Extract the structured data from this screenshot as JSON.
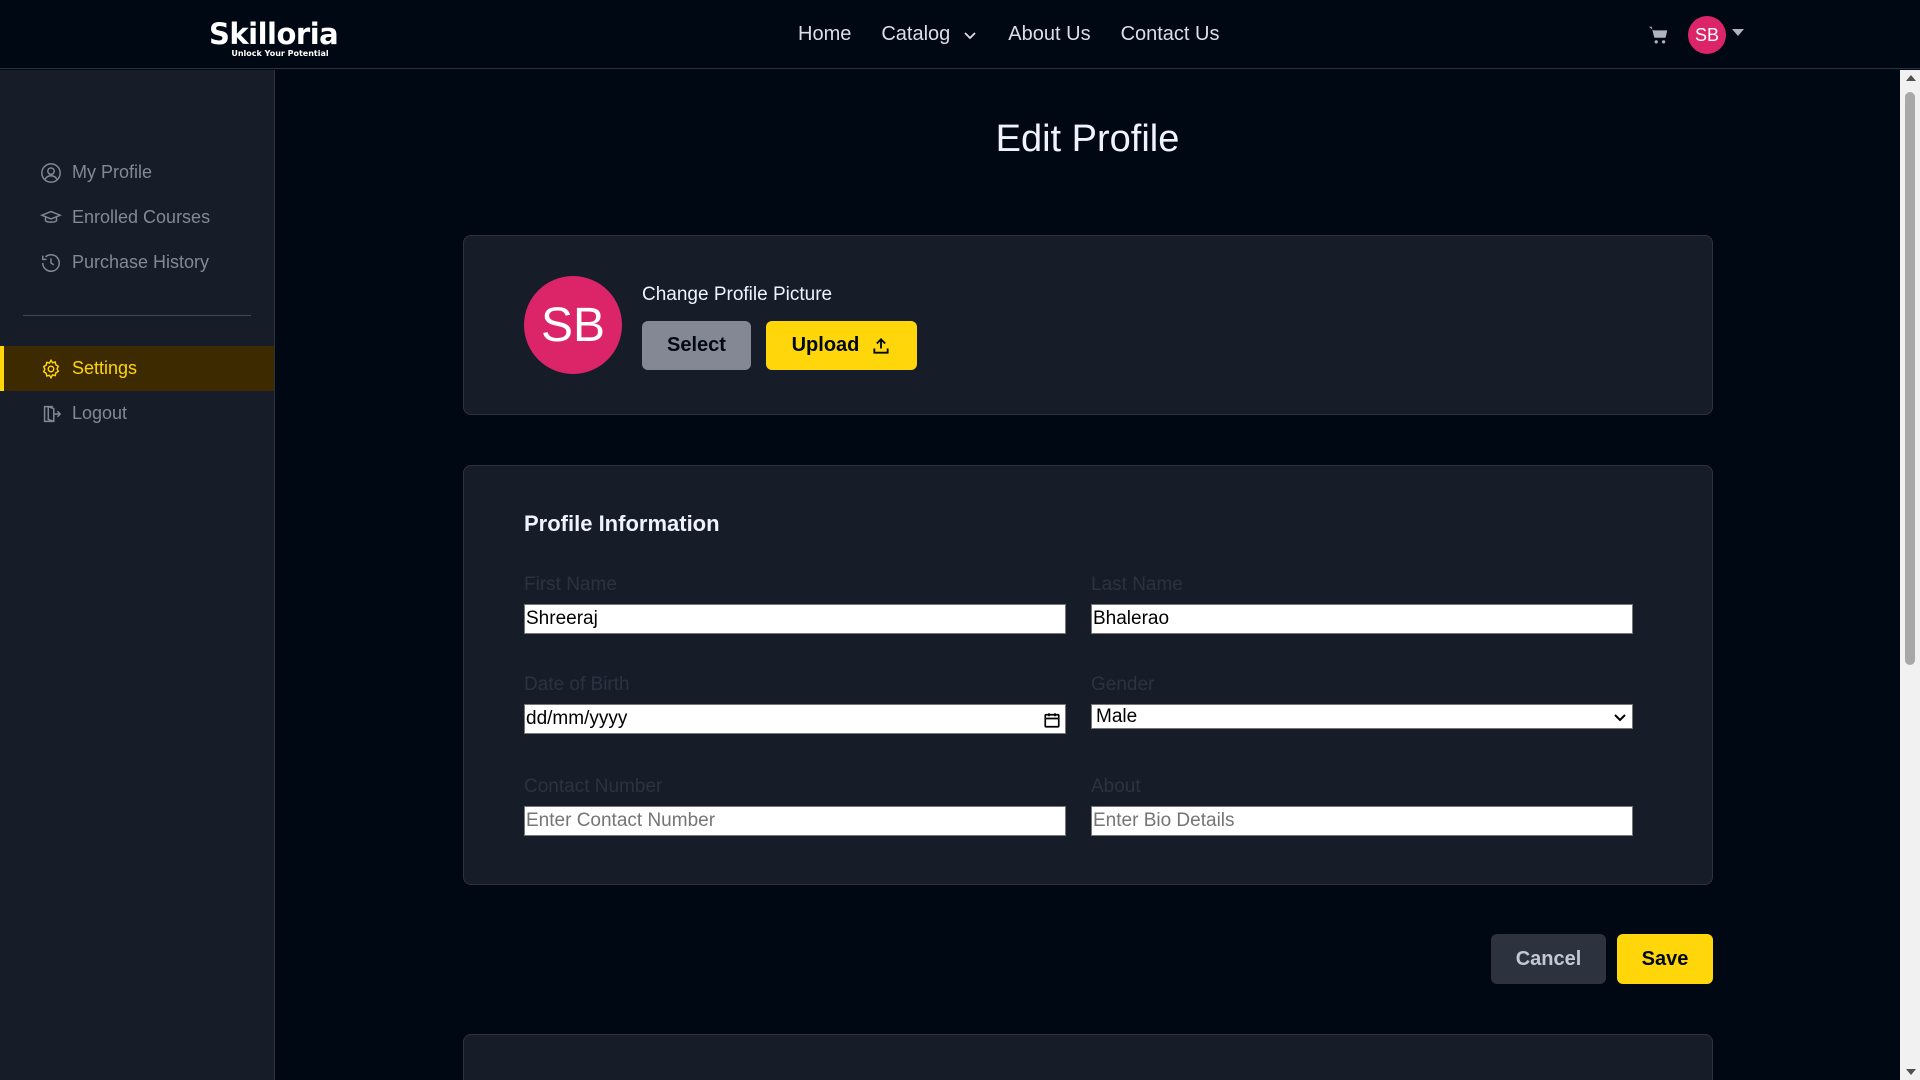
{
  "brand": {
    "name": "Skilloria",
    "tagline": "Unlock Your Potential"
  },
  "nav": {
    "links": [
      "Home",
      "Catalog",
      "About Us",
      "Contact Us"
    ],
    "user_initials": "SB"
  },
  "sidebar": {
    "items": [
      {
        "label": "My Profile",
        "icon": "user-circle-icon"
      },
      {
        "label": "Enrolled Courses",
        "icon": "graduation-cap-icon"
      },
      {
        "label": "Purchase History",
        "icon": "history-icon"
      }
    ],
    "settings_label": "Settings",
    "logout_label": "Logout",
    "active": "Settings",
    "active_color": "#FFD60A"
  },
  "page": {
    "title": "Edit Profile"
  },
  "profile_picture": {
    "initials": "SB",
    "label": "Change Profile Picture",
    "select_label": "Select",
    "upload_label": "Upload"
  },
  "profile_info": {
    "title": "Profile Information",
    "first_name": {
      "label": "First Name",
      "value": "Shreeraj"
    },
    "last_name": {
      "label": "Last Name",
      "value": "Bhalerao"
    },
    "dob": {
      "label": "Date of Birth",
      "value": "dd/mm/yyyy"
    },
    "gender": {
      "label": "Gender",
      "value": "Male"
    },
    "contact": {
      "label": "Contact Number",
      "placeholder": "Enter Contact Number"
    },
    "about": {
      "label": "About",
      "placeholder": "Enter Bio Details"
    }
  },
  "actions": {
    "cancel_label": "Cancel",
    "save_label": "Save"
  },
  "colors": {
    "accent": "#FFD60A",
    "avatar": "#DC2568",
    "background": "#000814",
    "panel": "#161D29"
  }
}
